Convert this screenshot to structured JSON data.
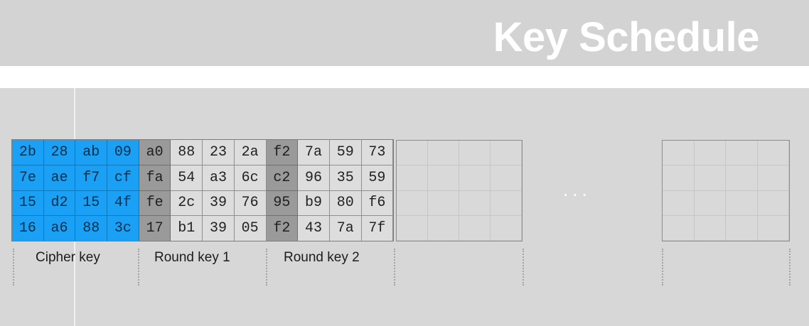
{
  "title": "Key Schedule",
  "ellipsis": "...",
  "labels": [
    "Cipher key",
    "Round key 1",
    "Round key 2"
  ],
  "rows": [
    [
      "2b",
      "28",
      "ab",
      "09",
      "a0",
      "88",
      "23",
      "2a",
      "f2",
      "7a",
      "59",
      "73"
    ],
    [
      "7e",
      "ae",
      "f7",
      "cf",
      "fa",
      "54",
      "a3",
      "6c",
      "c2",
      "96",
      "35",
      "59"
    ],
    [
      "15",
      "d2",
      "15",
      "4f",
      "fe",
      "2c",
      "39",
      "76",
      "95",
      "b9",
      "80",
      "f6"
    ],
    [
      "16",
      "a6",
      "88",
      "3c",
      "17",
      "b1",
      "39",
      "05",
      "f2",
      "43",
      "7a",
      "7f"
    ]
  ],
  "colors": {
    "cipher_key": "#1aa0f5",
    "highlight_column": "#9a9a9a",
    "round_key": "#dddddd",
    "title": "#ffffff",
    "background": "#d6d6d6"
  }
}
